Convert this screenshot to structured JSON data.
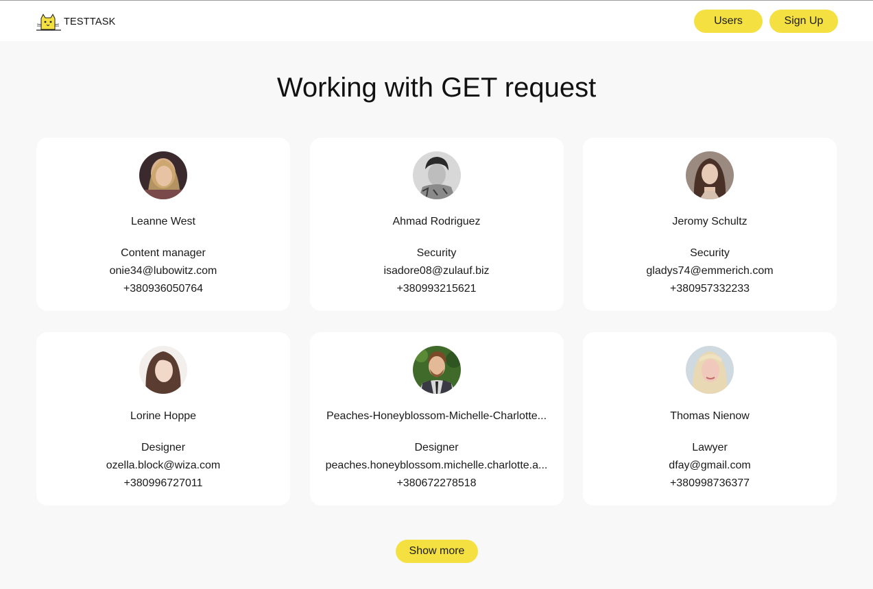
{
  "header": {
    "logo_text": "TESTTASK",
    "nav": {
      "users_label": "Users",
      "signup_label": "Sign Up"
    }
  },
  "main": {
    "title": "Working with GET request",
    "show_more_label": "Show more"
  },
  "users": [
    {
      "name": "Leanne West",
      "position": "Content manager",
      "email": "onie34@lubowitz.com",
      "phone": "+380936050764"
    },
    {
      "name": "Ahmad Rodriguez",
      "position": "Security",
      "email": "isadore08@zulauf.biz",
      "phone": "+380993215621"
    },
    {
      "name": "Jeromy Schultz",
      "position": "Security",
      "email": "gladys74@emmerich.com",
      "phone": "+380957332233"
    },
    {
      "name": "Lorine Hoppe",
      "position": "Designer",
      "email": "ozella.block@wiza.com",
      "phone": "+380996727011"
    },
    {
      "name": "Peaches-Honeyblossom-Michelle-Charlotte...",
      "position": "Designer",
      "email": "peaches.honeyblossom.michelle.charlotte.a...",
      "phone": "+380672278518"
    },
    {
      "name": "Thomas Nienow",
      "position": "Lawyer",
      "email": "dfay@gmail.com",
      "phone": "+380998736377"
    }
  ],
  "colors": {
    "accent": "#f4e041",
    "background": "#f8f8f8",
    "card": "#ffffff"
  }
}
